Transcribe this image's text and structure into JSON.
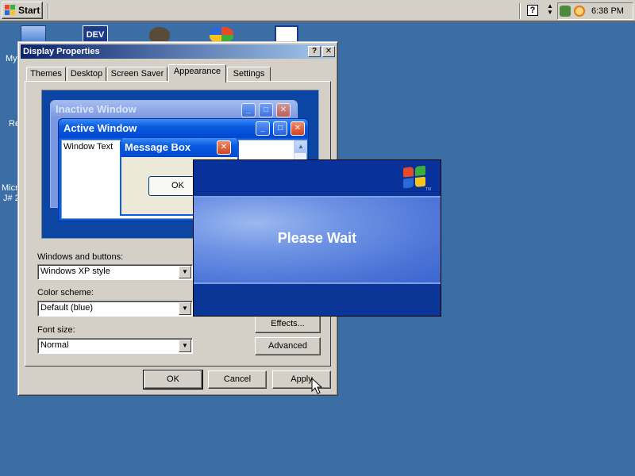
{
  "taskbar": {
    "start_label": "Start",
    "help_glyph": "?",
    "arrows_glyph": "⇕",
    "clock": "6:38 PM",
    "tray_icons": [
      "network-icon",
      "search-icon"
    ]
  },
  "desktop": {
    "labels": [
      "My",
      "Re",
      "Micr",
      "J# 2"
    ],
    "icon_names": [
      "my-computer-icon",
      "dev-icon",
      "raccoon-icon",
      "msn-icon",
      "document-icon"
    ],
    "dev_icon_text": "DEV"
  },
  "dialog": {
    "title": "Display Properties",
    "help_btn": "?",
    "close_btn": "✕",
    "tabs": [
      "Themes",
      "Desktop",
      "Screen Saver",
      "Appearance",
      "Settings"
    ],
    "active_tab": "Appearance",
    "preview": {
      "inactive_title": "Inactive Window",
      "active_title": "Active Window",
      "window_text": "Window Text",
      "message_title": "Message Box",
      "ok_label": "OK"
    },
    "windows_buttons_label": "Windows and buttons:",
    "windows_buttons_value": "Windows XP style",
    "color_scheme_label": "Color scheme:",
    "color_scheme_value": "Default (blue)",
    "font_size_label": "Font size:",
    "font_size_value": "Normal",
    "effects_label": "Effects...",
    "advanced_label": "Advanced",
    "ok_label": "OK",
    "cancel_label": "Cancel",
    "apply_label": "Apply"
  },
  "splash": {
    "message": "Please Wait",
    "trademark": "TM"
  },
  "colors": {
    "desktop": "#3a6ea5",
    "face": "#d4d0c8",
    "title_start": "#0a246a",
    "title_end": "#a6caf0",
    "xp_blue": "#0a5ce0"
  }
}
